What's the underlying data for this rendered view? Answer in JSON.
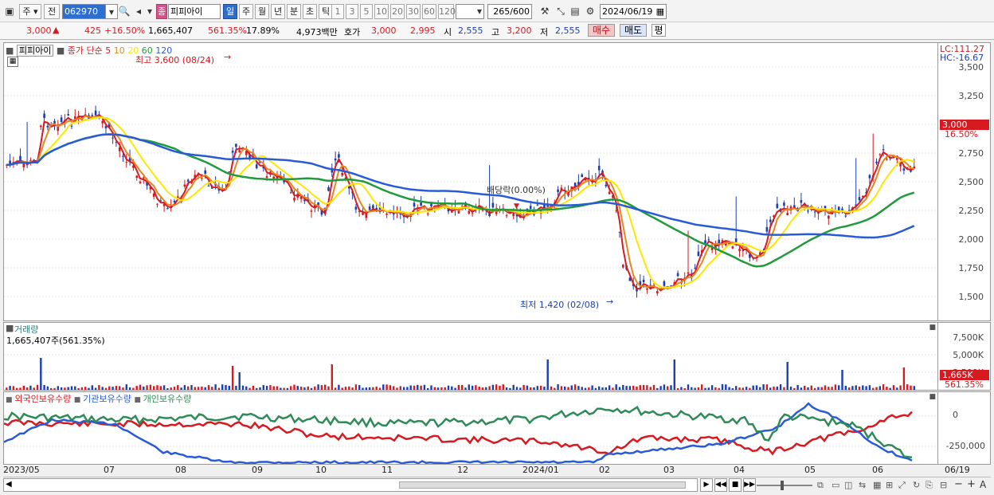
{
  "toolbar": {
    "market": "주",
    "prev": "전",
    "code": "062970",
    "name_badge": "종",
    "name": "피피아이",
    "periods": [
      "일",
      "주",
      "월",
      "년",
      "분",
      "초",
      "틱"
    ],
    "selected_period": "일",
    "minutes": [
      "1",
      "3",
      "5",
      "10",
      "20",
      "30",
      "60",
      "120"
    ],
    "count_value": "265",
    "count_total": "/600",
    "date": "2024/06/19"
  },
  "quote": {
    "price": "3,000",
    "change": "425",
    "change_pct": "+16.50%",
    "volume": "1,665,407",
    "volume_ratio": "561.35%",
    "turnover": "17.89%",
    "amount": "4,973백만",
    "ask_label": "호가",
    "ask": "3,000",
    "bid": "2,995",
    "open_label": "시",
    "open": "2,555",
    "high_label": "고",
    "high": "3,200",
    "low_label": "저",
    "low": "2,555",
    "buy_label": "매수",
    "sell_label": "매도",
    "eval_label": "평"
  },
  "price_panel": {
    "name_label": "피피아이",
    "ma_title": "종가 단순",
    "ma_periods": [
      "5",
      "10",
      "20",
      "60",
      "120"
    ],
    "ma_colors": [
      "#d71920",
      "#e8851e",
      "#ffe600",
      "#1f9a3c",
      "#2a5bd7"
    ],
    "lc": "LC:111.27",
    "hc": "HC:-16.67",
    "high_note": "최고 3,600 (08/24)",
    "low_note": "최저 1,420 (02/08)",
    "event_note": "배당락(0.00%)",
    "current_tag": "3,000",
    "current_pct": "16.50%",
    "y_ticks": [
      "3,500",
      "3,250",
      "3,000",
      "2,750",
      "2,500",
      "2,250",
      "2,000",
      "1,750",
      "1,500"
    ]
  },
  "volume_panel": {
    "title": "거래량",
    "value": "1,665,407주(561.35%)",
    "y_ticks": [
      "7,500K",
      "5,000K",
      "2,500K"
    ],
    "current_tag": "1,665K",
    "current_pct": "561.35%"
  },
  "holding_panel": {
    "legend": [
      "외국인보유수량",
      "기관보유수량",
      "개인보유수량"
    ],
    "legend_colors": [
      "#d71920",
      "#2a5bd7",
      "#2e8b57"
    ],
    "y_ticks": [
      "0",
      "-250,000"
    ]
  },
  "x_axis": {
    "labels": [
      "2023/05",
      "07",
      "08",
      "09",
      "10",
      "11",
      "12",
      "2024/01",
      "02",
      "03",
      "04",
      "05",
      "06",
      "06/19"
    ]
  },
  "bottom_nav": [
    "▶",
    "◀◀",
    "■",
    "▶▶"
  ]
}
